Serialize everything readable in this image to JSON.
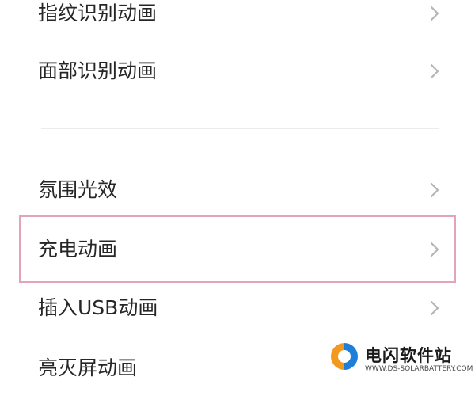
{
  "settings": {
    "items": [
      {
        "label": "指纹识别动画"
      },
      {
        "label": "面部识别动画"
      },
      {
        "label": "氛围光效"
      },
      {
        "label": "充电动画",
        "highlighted": true
      },
      {
        "label": "插入USB动画"
      },
      {
        "label": "亮灭屏动画"
      }
    ]
  },
  "watermark": {
    "name": "电闪软件站",
    "url": "WWW.DS-SOLARBATTERY.COM"
  },
  "colors": {
    "highlight_border": "#e4a3bb",
    "chevron": "#b5b5b5",
    "logo_orange": "#f29a1f",
    "logo_blue": "#1e7fd8"
  }
}
